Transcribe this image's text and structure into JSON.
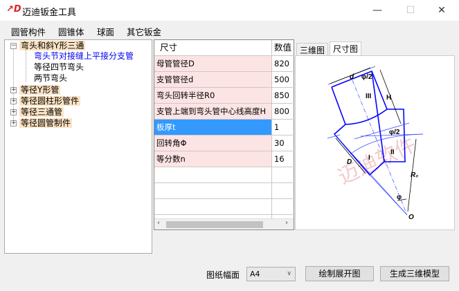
{
  "window": {
    "title": "迈迪钣金工具",
    "logo_icon": "maidi-logo-icon",
    "minimize": "—",
    "maximize": "☐",
    "close": "✕"
  },
  "menu": [
    "圆管构件",
    "圆锥体",
    "球面",
    "其它钣金"
  ],
  "tree": {
    "items": [
      {
        "label": "弯头和斜Y形三通",
        "expanded": true,
        "toggle": "−"
      },
      {
        "label": "弯头节对接缝上平接分支管",
        "selected": true
      },
      {
        "label": "等径四节弯头"
      },
      {
        "label": "两节弯头"
      },
      {
        "label": "等径Y形管",
        "toggle": "+"
      },
      {
        "label": "等径圆柱形管件",
        "toggle": "+"
      },
      {
        "label": "等径三通管",
        "toggle": "+"
      },
      {
        "label": "等径圆管制件",
        "toggle": "+"
      }
    ]
  },
  "table": {
    "headers": [
      "尺寸",
      "数值"
    ],
    "rows": [
      {
        "name": "母管管径D",
        "value": "820"
      },
      {
        "name": "支管管径d",
        "value": "500"
      },
      {
        "name": "弯头回转半径R0",
        "value": "850"
      },
      {
        "name": "支管上端到弯头管中心线高度H",
        "value": "800"
      },
      {
        "name": "板厚t",
        "value": "1",
        "selected": true
      },
      {
        "name": "回转角Φ",
        "value": "30"
      },
      {
        "name": "等分数n",
        "value": "16"
      }
    ]
  },
  "tabs": [
    {
      "label": "三维图"
    },
    {
      "label": "尺寸图",
      "active": true
    }
  ],
  "diagram": {
    "labels": {
      "d": "d",
      "phi_half_top": "φ/2",
      "H": "H",
      "III": "III",
      "phi_half_mid": "φ/2",
      "II": "II",
      "I": "I",
      "D": "D",
      "R0": "R₀",
      "phi": "φ",
      "O": "O"
    },
    "watermark": "迈迪软件",
    "line_color": "#0000ff"
  },
  "bottom": {
    "paper_label": "图纸幅面",
    "paper_value": "A4",
    "draw_button": "绘制展开图",
    "model_button": "生成三维模型"
  }
}
